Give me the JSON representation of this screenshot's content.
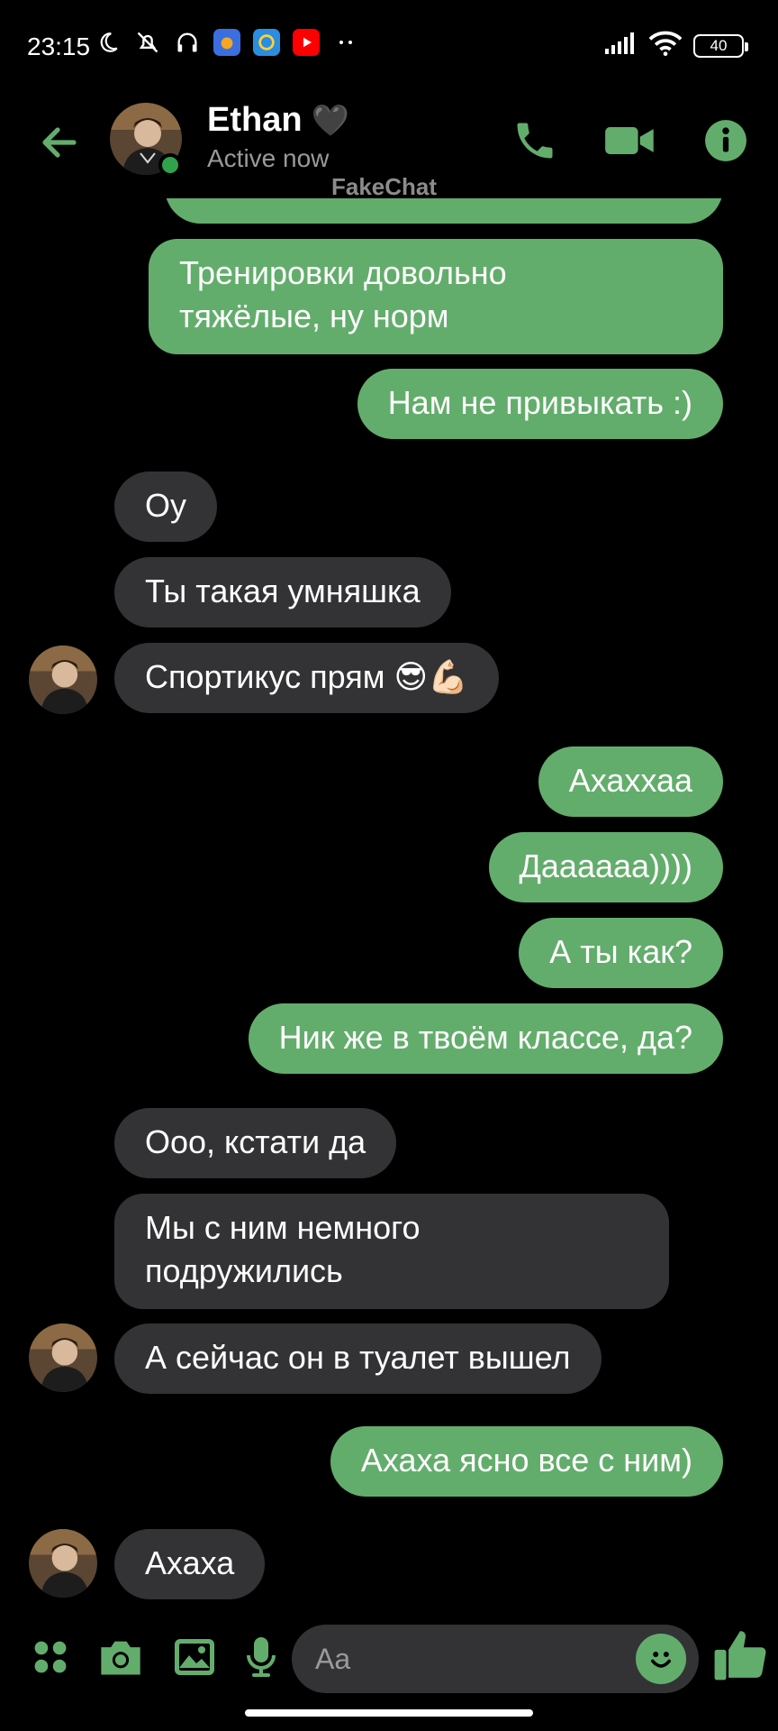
{
  "status_bar": {
    "time": "23:15",
    "battery": "40",
    "icons_left": [
      "moon-icon",
      "bell-muted-icon",
      "headphones-icon",
      "app-cloud-icon",
      "app-blue-icon",
      "youtube-icon",
      "more-dots-icon"
    ],
    "icons_right": [
      "signal-icon",
      "wifi-icon",
      "battery-icon"
    ]
  },
  "header": {
    "contact_name": "Ethan",
    "name_emoji": "🖤",
    "status": "Active now",
    "watermark": "FakeChat",
    "actions": [
      "phone-icon",
      "video-call-icon",
      "info-icon"
    ]
  },
  "messages": [
    {
      "dir": "out",
      "text": ""
    },
    {
      "dir": "out",
      "lines": [
        "Тренировки довольно",
        "тяжёлые, ну норм"
      ]
    },
    {
      "dir": "out",
      "text": "Нам не привыкать :)"
    },
    {
      "dir": "in",
      "text": "Оу"
    },
    {
      "dir": "in",
      "text": "Ты такая умняшка"
    },
    {
      "dir": "in",
      "text": "Спортикус прям",
      "emoji": "😎💪🏻"
    },
    {
      "dir": "out",
      "text": "Ахаххаа"
    },
    {
      "dir": "out",
      "text": "Даааааа))))"
    },
    {
      "dir": "out",
      "text": "А ты как?"
    },
    {
      "dir": "out",
      "text": "Ник же в твоём классе, да?"
    },
    {
      "dir": "in",
      "text": "Ооо, кстати да"
    },
    {
      "dir": "in",
      "lines": [
        "Мы с ним немного",
        "подружились"
      ]
    },
    {
      "dir": "in",
      "text": "А сейчас он в туалет вышел"
    },
    {
      "dir": "out",
      "text": "Ахаха ясно все с ним)"
    },
    {
      "dir": "in",
      "text": "Ахаха"
    }
  ],
  "composer": {
    "placeholder": "Aa",
    "buttons": [
      "apps-icon",
      "camera-icon",
      "gallery-icon",
      "microphone-icon",
      "emoji-icon",
      "thumbs-up-icon"
    ]
  },
  "colors": {
    "accent": "#63ad6c",
    "outgoing_bubble": "#63ad6c",
    "incoming_bubble": "#333335",
    "background": "#000000",
    "online": "#31a24c"
  }
}
